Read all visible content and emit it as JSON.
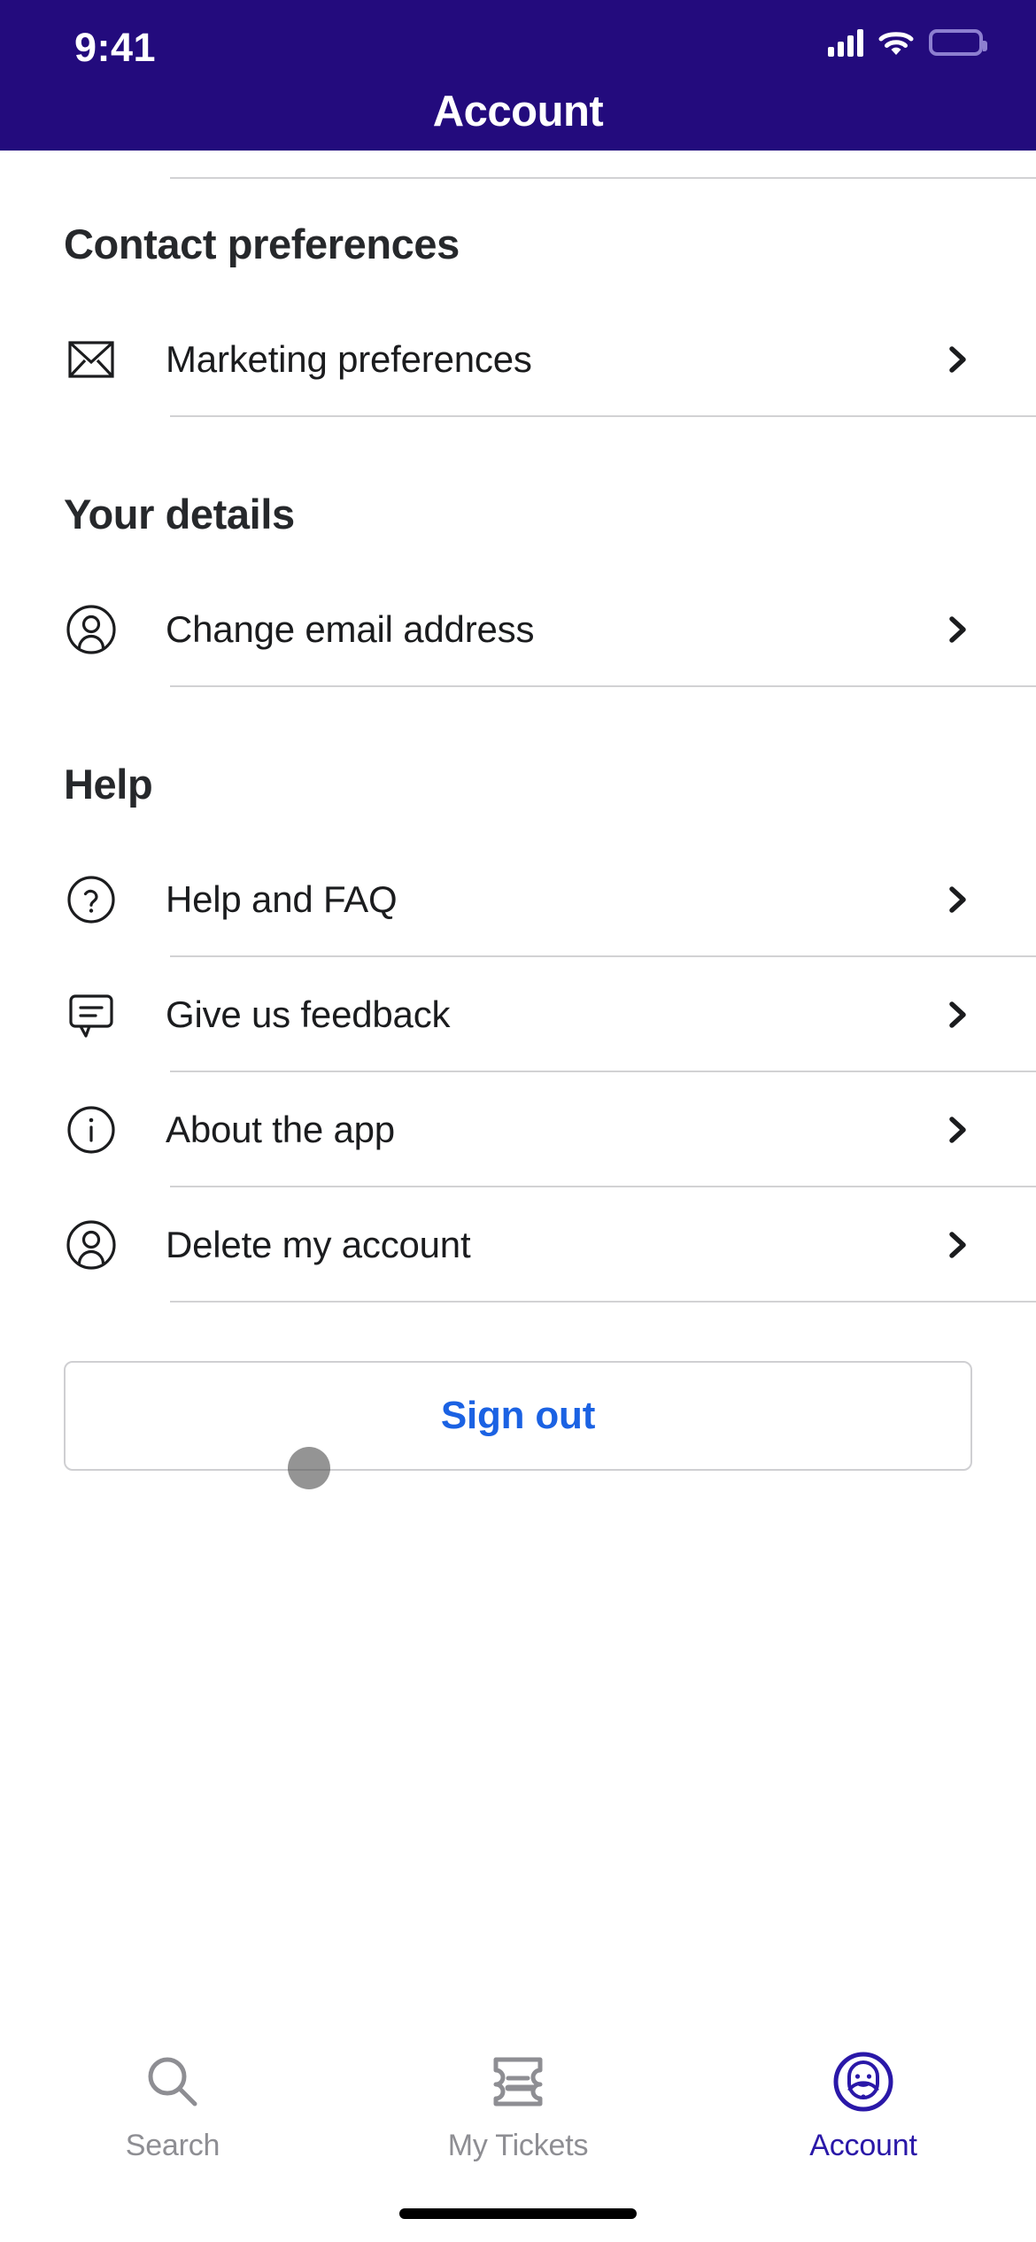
{
  "status_bar": {
    "time": "9:41",
    "signal_icon": "cellular-signal-icon",
    "wifi_icon": "wifi-icon",
    "battery_icon": "battery-icon"
  },
  "header": {
    "title": "Account",
    "background_color": "#230B7D",
    "title_color": "#FFFFFF"
  },
  "sections": [
    {
      "title": "Contact preferences",
      "rows": [
        {
          "icon": "envelope-icon",
          "label": "Marketing preferences",
          "chevron": "chevron-right-icon"
        }
      ]
    },
    {
      "title": "Your details",
      "rows": [
        {
          "icon": "person-circle-icon",
          "label": "Change email address",
          "chevron": "chevron-right-icon"
        }
      ]
    },
    {
      "title": "Help",
      "rows": [
        {
          "icon": "question-circle-icon",
          "label": "Help and FAQ",
          "chevron": "chevron-right-icon"
        },
        {
          "icon": "speech-bubble-icon",
          "label": "Give us feedback",
          "chevron": "chevron-right-icon"
        },
        {
          "icon": "info-circle-icon",
          "label": "About the app",
          "chevron": "chevron-right-icon"
        },
        {
          "icon": "person-circle-icon",
          "label": "Delete my account",
          "chevron": "chevron-right-icon"
        }
      ]
    }
  ],
  "sign_out": {
    "label": "Sign out",
    "text_color": "#1B62E3",
    "border_color": "#CFCFD2"
  },
  "tab_bar": {
    "items": [
      {
        "icon": "search-icon",
        "label": "Search",
        "active": false
      },
      {
        "icon": "ticket-icon",
        "label": "My Tickets",
        "active": false
      },
      {
        "icon": "account-face-icon",
        "label": "Account",
        "active": true
      }
    ],
    "active_color": "#2A18A8",
    "inactive_color": "#8E8E93"
  },
  "touch_indicator": {
    "visible": true,
    "color": "#525252"
  },
  "home_indicator": {
    "color": "#000000"
  }
}
